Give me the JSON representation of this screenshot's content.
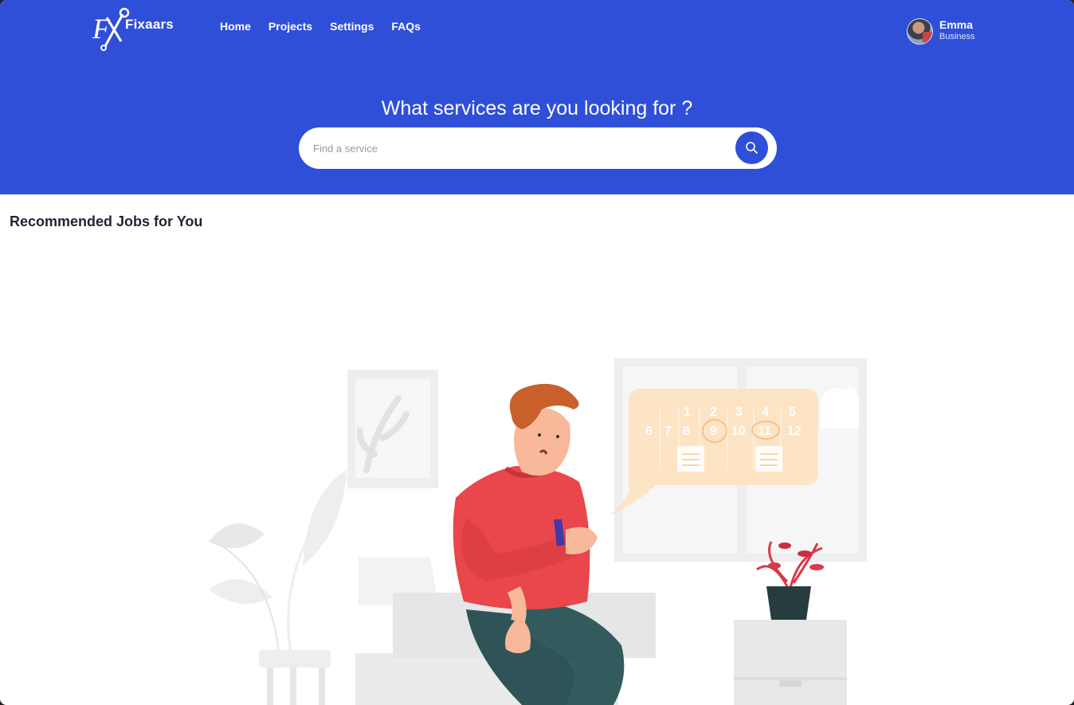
{
  "brand": {
    "name": "Fixaars",
    "mark": "FX"
  },
  "nav": [
    {
      "label": "Home"
    },
    {
      "label": "Projects"
    },
    {
      "label": "Settings"
    },
    {
      "label": "FAQs"
    }
  ],
  "user": {
    "name": "Emma",
    "role": "Business"
  },
  "hero": {
    "title": "What services are you looking for ?",
    "search_placeholder": "Find a service",
    "search_value": ""
  },
  "section": {
    "title": "Recommended Jobs for You"
  },
  "calendar": {
    "row1": [
      "1",
      "2",
      "3",
      "4",
      "5"
    ],
    "row2": [
      "6",
      "7",
      "8",
      "9",
      "10",
      "11",
      "12"
    ]
  },
  "colors": {
    "header": "#2f4fd8",
    "accent": "#2f4fd8",
    "shirt": "#e9474b",
    "calendar_bubble": "#fde4c4"
  }
}
